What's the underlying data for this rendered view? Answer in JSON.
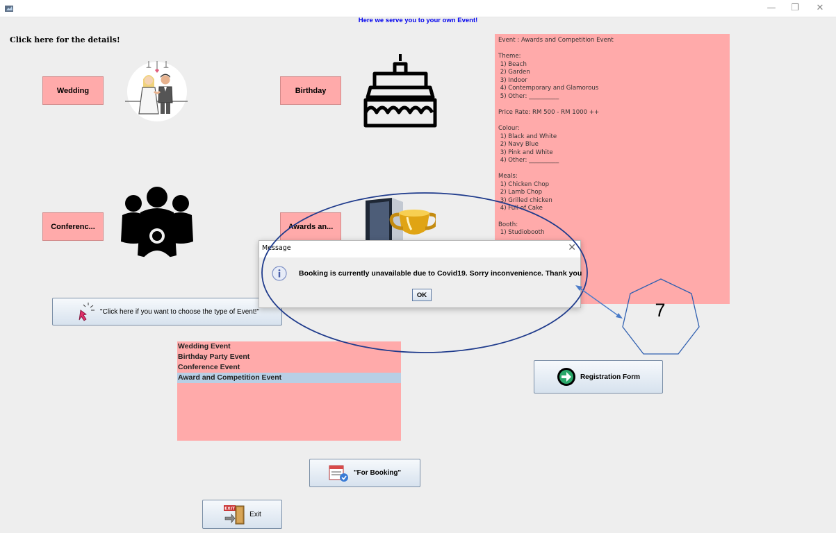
{
  "window": {
    "minimize_glyph": "—",
    "maximize_glyph": "❐",
    "close_glyph": "✕"
  },
  "header": {
    "title": "Here we serve you to your own Event!"
  },
  "details": {
    "label": "Click here for the details!"
  },
  "event_buttons": {
    "wedding": "Wedding",
    "birthday": "Birthday",
    "conference": "Conferenc...",
    "awards": "Awards an..."
  },
  "icons": {
    "wedding": "wedding-couple-icon",
    "birthday": "birthday-cake-icon",
    "conference": "people-group-icon",
    "awards": "trophy-icon",
    "choose": "cursor-click-icon",
    "registration": "arrow-right-circle-icon",
    "booking": "booking-icon",
    "exit": "exit-door-icon",
    "info": "info-icon"
  },
  "info_panel": {
    "text": "Event : Awards and Competition Event\n\nTheme:\n 1) Beach\n 2) Garden\n 3) Indoor\n 4) Contemporary and Glamorous\n 5) Other: __________\n\nPrice Rate: RM 500 - RM 1000 ++\n\nColour:\n 1) Black and White\n 2) Navy Blue\n 3) Pink and White\n 4) Other: __________\n\nMeals:\n 1) Chicken Chop\n 2) Lamb Chop\n 3) Grilled chicken\n 4) Full of Cake\n\nBooth:\n 1) Studiobooth"
  },
  "choose_button": {
    "label": "\"Click here if you want to choose the type of Event!\""
  },
  "event_list": {
    "items": [
      "Wedding Event",
      "Birthday Party Event",
      "Conference Event",
      "Award and Competition Event"
    ],
    "selected": "Award and Competition Event"
  },
  "registration_button": {
    "label": "Registration Form"
  },
  "booking_button": {
    "label": "\"For Booking\""
  },
  "exit_button": {
    "label": "Exit"
  },
  "dialog": {
    "title": "Message",
    "close_glyph": "✕",
    "message": "Booking is currently unavailable due to Covid19. Sorry inconvenience. Thank you",
    "ok_label": "OK"
  },
  "annotation": {
    "number": "7"
  },
  "colors": {
    "pink": "#ffaaaa",
    "header_blue": "#0000ee",
    "selection": "#b8cfe5",
    "annotation_blue": "#3060b0",
    "annotation_arrow": "#4a7bc8"
  }
}
